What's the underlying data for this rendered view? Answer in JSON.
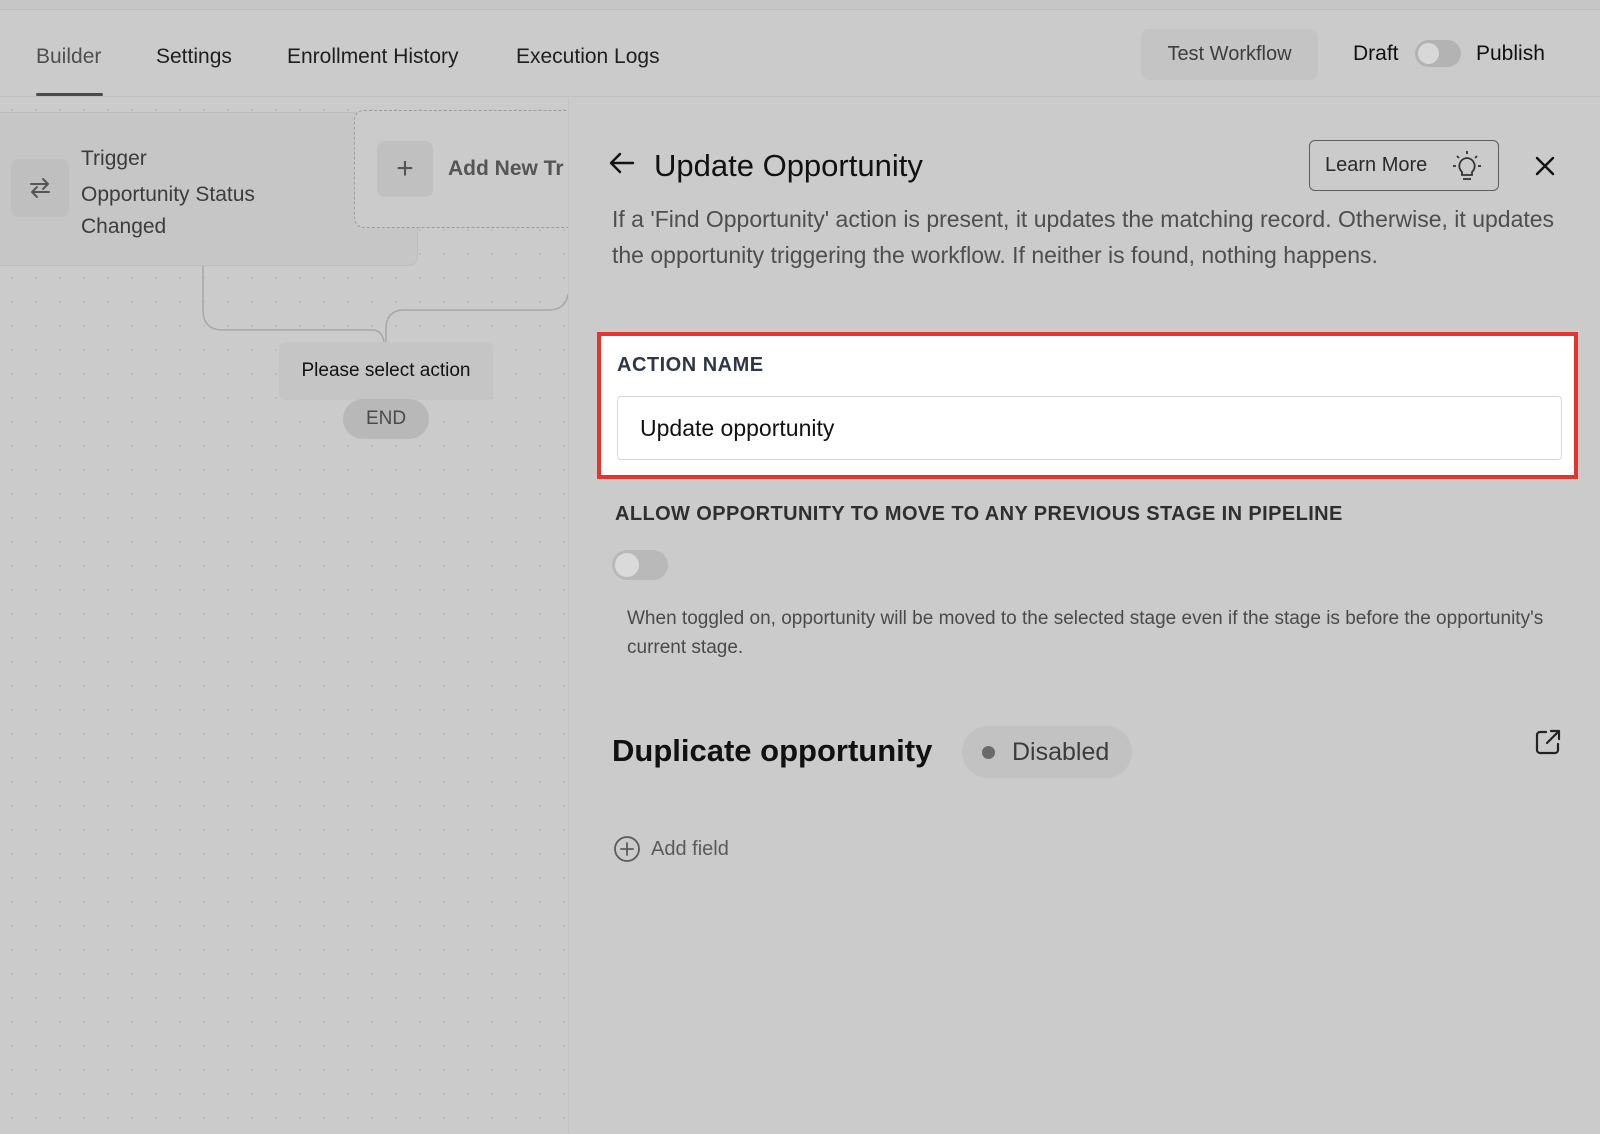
{
  "tabs": [
    {
      "label": "Builder",
      "active": true
    },
    {
      "label": "Settings",
      "active": false
    },
    {
      "label": "Enrollment History",
      "active": false
    },
    {
      "label": "Execution Logs",
      "active": false
    }
  ],
  "header": {
    "test_workflow": "Test Workflow",
    "draft": "Draft",
    "publish": "Publish",
    "publish_toggle_on": false
  },
  "canvas": {
    "trigger_title": "Trigger",
    "trigger_subtitle": "Opportunity Status Changed",
    "add_new_label": "Add New Tr",
    "select_action": "Please select action",
    "end": "END"
  },
  "panel": {
    "title": "Update Opportunity",
    "learn_more": "Learn More",
    "description": "If a 'Find Opportunity' action is present, it updates the matching record. Otherwise, it updates the opportunity triggering the workflow. If neither is found, nothing happens.",
    "action_name_label": "ACTION NAME",
    "action_name_value": "Update opportunity",
    "allow_label": "ALLOW OPPORTUNITY TO MOVE TO ANY PREVIOUS STAGE IN PIPELINE",
    "allow_toggle_on": false,
    "allow_help": "When toggled on, opportunity will be moved to the selected stage even if the stage is before the opportunity's current stage.",
    "duplicate_title": "Duplicate opportunity",
    "duplicate_status": "Disabled",
    "add_field": "Add field"
  },
  "colors": {
    "highlight_border": "#e8332a",
    "overlay_gray": "#cbcbcb"
  },
  "icons": [
    "swap-arrows-icon",
    "plus-icon",
    "back-arrow-icon",
    "lightbulb-icon",
    "close-icon",
    "external-link-icon",
    "add-circle-icon"
  ]
}
